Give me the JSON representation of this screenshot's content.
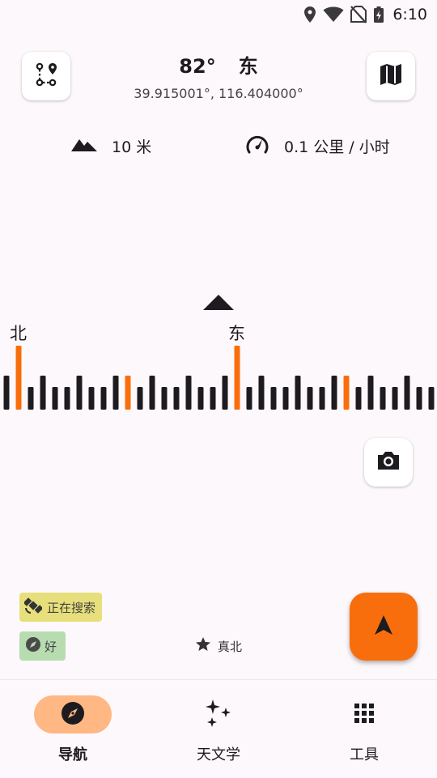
{
  "status_bar": {
    "time": "6:10",
    "icons": [
      "location-icon",
      "wifi-icon",
      "no-sim-icon",
      "battery-charging-icon"
    ]
  },
  "header": {
    "azimuth": "82°",
    "direction": "东",
    "coordinates": "39.915001°, 116.404000°",
    "left_button_icon": "route-icon",
    "right_button_icon": "map-icon"
  },
  "stats": {
    "elevation": "10 米",
    "speed": "0.1 公里 / 小时"
  },
  "compass": {
    "labels": [
      "北",
      "东"
    ],
    "accent_color": "#f96e0c",
    "tick_color": "#1d1b1f"
  },
  "indicators": {
    "gps_status": "正在搜索",
    "accuracy": "好",
    "north_mode": "真北"
  },
  "nav": {
    "items": [
      {
        "label": "导航",
        "icon": "compass-icon",
        "active": true
      },
      {
        "label": "天文学",
        "icon": "sparkle-icon",
        "active": false
      },
      {
        "label": "工具",
        "icon": "apps-grid-icon",
        "active": false
      }
    ]
  }
}
